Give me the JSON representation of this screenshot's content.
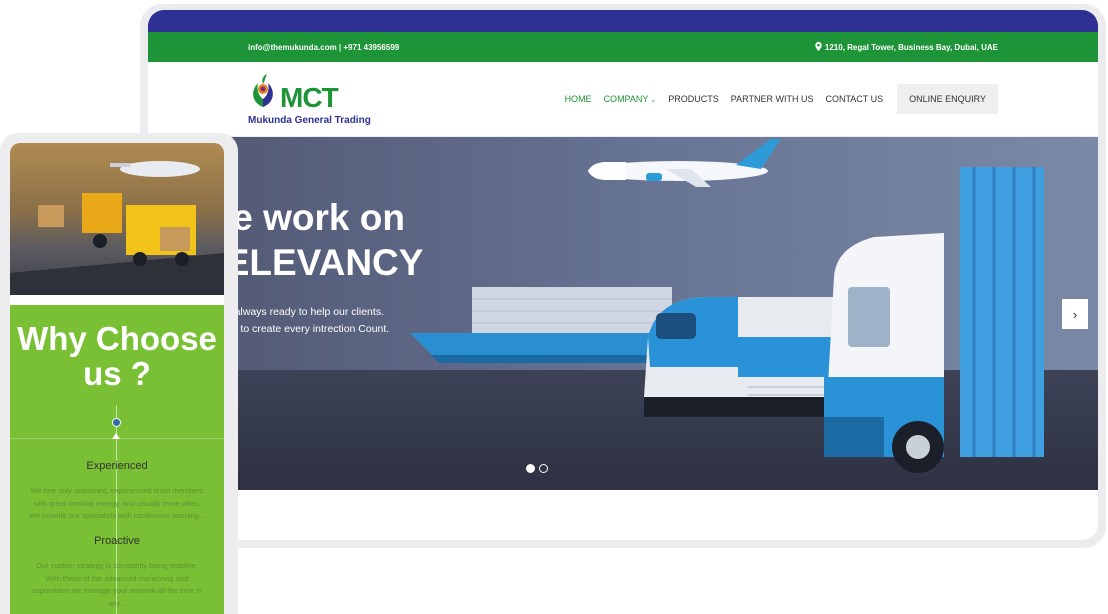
{
  "topbar": {
    "contact": "info@themukunda.com | +971 43956599",
    "address": "1210, Regal Tower, Business Bay, Dubai, UAE"
  },
  "logo": {
    "mark": "MCT",
    "name": "Mukunda General Trading"
  },
  "menu": {
    "items": [
      "HOME",
      "COMPANY",
      "PRODUCTS",
      "PARTNER WITH US",
      "CONTACT US"
    ],
    "cta": "ONLINE ENQUIRY"
  },
  "hero": {
    "title_line1": "We work on",
    "title_line2": "RELEVANCY",
    "text_line1": "We are always ready to help our clients.",
    "text_line2": "We wish to create every intrection Count.",
    "slide_index": 1,
    "slide_count": 2
  },
  "mobile": {
    "heading": "Why Choose us ?",
    "item1_title": "Experienced",
    "item1_text": "We hire only seasoned, experienced team members with great working energy, and usually more often. We provide our specialists with continuous learning...",
    "item2_title": "Proactive",
    "item2_text": "Our custom strategy is constantly being reactive. With these of the advanced monitoring and supervision we manage your network all the time in any..."
  },
  "colors": {
    "brand_blue": "#2e3192",
    "brand_green": "#1e9438",
    "mobile_green": "#79c035"
  }
}
